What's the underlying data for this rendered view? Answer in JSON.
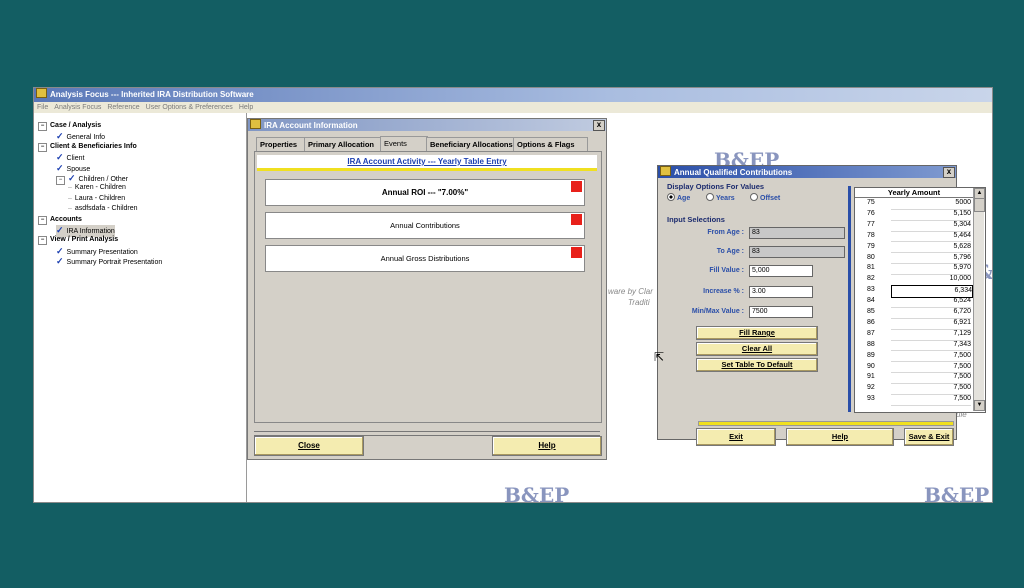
{
  "app": {
    "title": "Analysis Focus --- Inherited IRA Distribution Software",
    "menu": [
      "File",
      "Analysis Focus",
      "Reference",
      "User Options & Preferences",
      "Help"
    ]
  },
  "tree": {
    "items": [
      {
        "label": "Case / Analysis",
        "bold": true,
        "pm": "-"
      },
      {
        "label": "General Info",
        "check": true
      },
      {
        "label": "Client & Beneficiaries Info",
        "bold": true,
        "pm": "-"
      },
      {
        "label": "Client",
        "check": true
      },
      {
        "label": "Spouse",
        "check": true
      },
      {
        "label": "Children / Other",
        "check": true,
        "pm": "-"
      },
      {
        "label": "Karen - Children"
      },
      {
        "label": "Laura - Children"
      },
      {
        "label": "asdfsdafa - Children"
      },
      {
        "label": "Accounts",
        "bold": true,
        "pm": "-"
      },
      {
        "label": "IRA Information",
        "check": true,
        "selected": true
      },
      {
        "label": "View / Print Analysis",
        "bold": true,
        "pm": "-"
      },
      {
        "label": "Summary Presentation",
        "check": true
      },
      {
        "label": "Summary Portrait Presentation",
        "check": true
      }
    ]
  },
  "background": {
    "watermark": "B&EP",
    "ware_by": "ware by Clar",
    "tradit": "Traditi",
    "ule": "ule"
  },
  "ira": {
    "title": "IRA Account Information",
    "close_x": "x",
    "tabs": [
      "Properties",
      "Primary Allocation",
      "Events",
      "Beneficiary Allocations",
      "Options & Flags"
    ],
    "active_tab": "Events",
    "header": "IRA Account Activity --- Yearly Table Entry",
    "events": [
      {
        "label": "Annual ROI --- \"7.00%\"",
        "bold": true
      },
      {
        "label": "Annual Contributions"
      },
      {
        "label": "Annual Gross Distributions"
      }
    ],
    "close_button": "Close",
    "help_button": "Help"
  },
  "aqc": {
    "title": "Annual Qualified Contributions",
    "close_x": "x",
    "display_options_label": "Display Options For Values",
    "radio": [
      {
        "label": "Age",
        "on": true
      },
      {
        "label": "Years",
        "on": false
      },
      {
        "label": "Offset",
        "on": false
      }
    ],
    "input_selections_label": "Input Selections",
    "fields": [
      {
        "label": "From Age :",
        "value": "83",
        "readonly": true
      },
      {
        "label": "To Age :",
        "value": "83",
        "readonly": true
      },
      {
        "label": "Fill Value :",
        "value": "5,000",
        "readonly": false
      },
      {
        "label": "Increase % :",
        "value": "3.00",
        "readonly": false
      },
      {
        "label": "Min/Max Value :",
        "value": "7500",
        "readonly": false
      }
    ],
    "fill_range": "Fill Range",
    "clear_all": "Clear All",
    "set_default": "Set Table To Default",
    "table_header": "Yearly Amount",
    "rows": [
      {
        "age": "75",
        "amount": "5000"
      },
      {
        "age": "76",
        "amount": "5,150"
      },
      {
        "age": "77",
        "amount": "5,304"
      },
      {
        "age": "78",
        "amount": "5,464"
      },
      {
        "age": "79",
        "amount": "5,628"
      },
      {
        "age": "80",
        "amount": "5,796"
      },
      {
        "age": "81",
        "amount": "5,970"
      },
      {
        "age": "82",
        "amount": "10,000"
      },
      {
        "age": "83",
        "amount": "6,334",
        "current": true
      },
      {
        "age": "84",
        "amount": "6,524"
      },
      {
        "age": "85",
        "amount": "6,720"
      },
      {
        "age": "86",
        "amount": "6,921"
      },
      {
        "age": "87",
        "amount": "7,129"
      },
      {
        "age": "88",
        "amount": "7,343"
      },
      {
        "age": "89",
        "amount": "7,500"
      },
      {
        "age": "90",
        "amount": "7,500"
      },
      {
        "age": "91",
        "amount": "7,500"
      },
      {
        "age": "92",
        "amount": "7,500"
      },
      {
        "age": "93",
        "amount": "7,500"
      }
    ],
    "exit_button": "Exit",
    "help_button": "Help",
    "save_exit_button": "Save & Exit"
  }
}
